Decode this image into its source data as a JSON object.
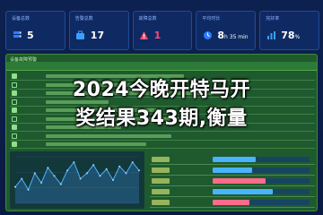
{
  "headline": {
    "line1": "2024今晚开特马开",
    "line2": "奖结果343期,衡量"
  },
  "stats": [
    {
      "label": "设备总数",
      "value": "5",
      "unit": "",
      "icon": "server-icon",
      "color": "#2f7bff"
    },
    {
      "label": "告警总数",
      "value": "17",
      "unit": "",
      "icon": "briefcase-icon",
      "color": "#3aa0ff"
    },
    {
      "label": "故障总数",
      "value": "1",
      "unit": "",
      "icon": "warning-icon",
      "color": "#ff4b6e"
    },
    {
      "label": "平均时长",
      "value": "8",
      "unit": "h 35 min",
      "icon": "clock-icon",
      "color": "#2f7bff"
    },
    {
      "label": "完好率",
      "value": "78",
      "unit": "%",
      "icon": "percent-icon",
      "color": "#3aa0ff"
    }
  ],
  "panel": {
    "title": "设备故障预警"
  },
  "rows": [
    {
      "checked": true,
      "fill": 0.55
    },
    {
      "checked": false,
      "fill": 0.35
    },
    {
      "checked": true,
      "fill": 0.7
    },
    {
      "checked": false,
      "fill": 0.25
    },
    {
      "checked": true,
      "fill": 0.45
    },
    {
      "checked": false,
      "fill": 0.6
    },
    {
      "checked": true,
      "fill": 0.3
    },
    {
      "checked": false,
      "fill": 0.5
    },
    {
      "checked": true,
      "fill": 0.4
    }
  ],
  "trend": [
    12,
    18,
    10,
    22,
    15,
    26,
    20,
    14,
    24,
    30,
    18,
    22,
    28,
    20,
    25,
    17,
    27,
    22,
    30,
    24
  ],
  "list": [
    {
      "fill": 0.44,
      "color": "#4ab3ff"
    },
    {
      "fill": 0.41,
      "color": "#4ab3ff"
    },
    {
      "fill": 0.55,
      "color": "#ff6b8a"
    },
    {
      "fill": 0.62,
      "color": "#4ab3ff"
    },
    {
      "fill": 0.38,
      "color": "#ff6b8a"
    }
  ]
}
